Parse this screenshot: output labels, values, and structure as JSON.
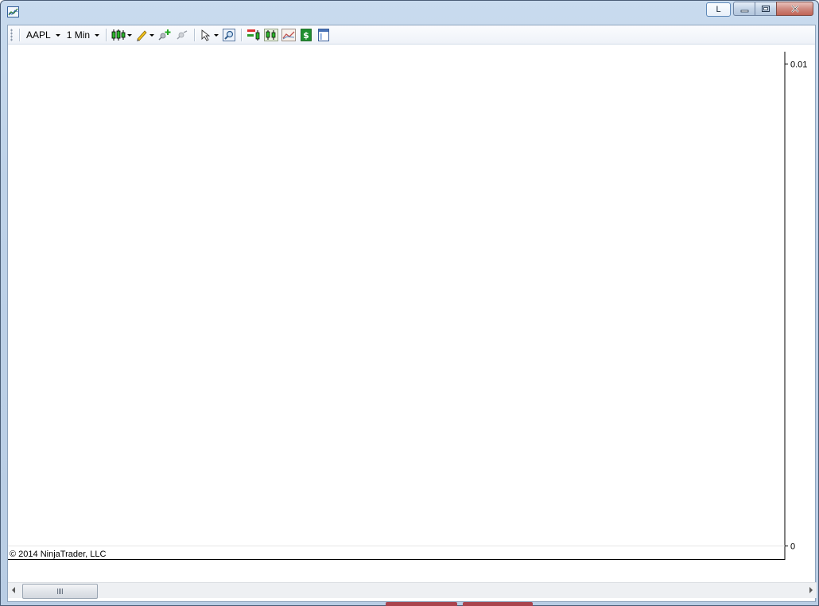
{
  "window": {
    "caption_l_label": "L",
    "icons": {
      "app": "chart-window-icon",
      "minimize": "minimize-icon",
      "maximize": "restore-icon",
      "close": "close-icon"
    }
  },
  "toolbar": {
    "instrument": "AAPL",
    "interval": "1 Min",
    "icons": [
      "chart-style-icon",
      "drawing-tools-icon",
      "add-indicator-icon",
      "remove-indicator-icon",
      "pointer-icon",
      "zoom-icon",
      "indicators-icon",
      "strategies-icon",
      "data-series-icon",
      "performance-icon",
      "properties-icon"
    ]
  },
  "chart": {
    "copyright": "© 2014 NinjaTrader, LLC"
  },
  "chart_data": {
    "type": "line",
    "title": "",
    "series": [],
    "y_ticks": [
      "0.01",
      "0"
    ],
    "ylim": [
      0,
      0.01
    ],
    "grid": false
  },
  "colors": {
    "accent": "#4a5d76",
    "axis": "#000000",
    "background": "#ffffff"
  }
}
